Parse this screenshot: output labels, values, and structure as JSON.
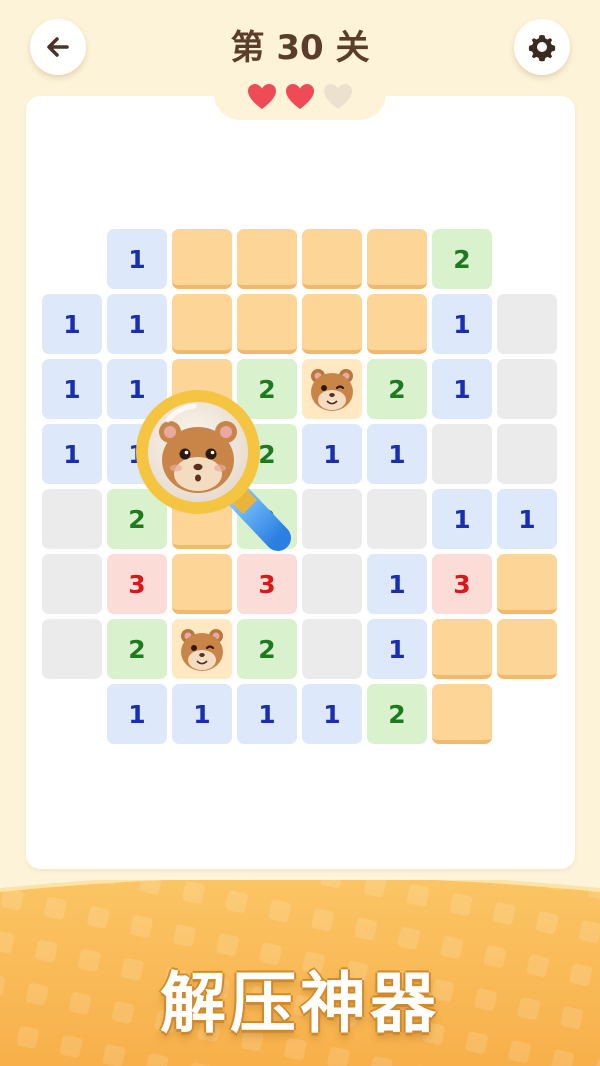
{
  "header": {
    "title": "第 30 关",
    "back_icon": "arrow-left-icon",
    "settings_icon": "gear-icon",
    "hearts": [
      {
        "state": "full",
        "color": "#ef4b57"
      },
      {
        "state": "full",
        "color": "#ef4b57"
      },
      {
        "state": "empty",
        "color": "#ece1cf"
      }
    ]
  },
  "board": {
    "columns": 8,
    "rows": 8,
    "cells": [
      [
        "none",
        "b1",
        "cov",
        "cov",
        "cov",
        "cov",
        "g2",
        "none"
      ],
      [
        "b1",
        "b1",
        "cov",
        "cov",
        "cov",
        "cov",
        "b1",
        "e"
      ],
      [
        "b1",
        "b1",
        "cov",
        "g2",
        "mole",
        "g2",
        "b1",
        "e"
      ],
      [
        "b1",
        "b1",
        "cov",
        "g2",
        "b1",
        "b1",
        "e",
        "e"
      ],
      [
        "e",
        "g2",
        "cov",
        "g2",
        "e",
        "e",
        "b1",
        "b1"
      ],
      [
        "e",
        "r3",
        "cov",
        "r3",
        "e",
        "b1",
        "r3",
        "cov"
      ],
      [
        "e",
        "g2",
        "mole",
        "g2",
        "e",
        "b1",
        "cov",
        "cov"
      ],
      [
        "none",
        "b1",
        "b1",
        "b1",
        "b1",
        "g2",
        "cov",
        "none"
      ]
    ],
    "labels": {
      "b1": "1",
      "g2": "2",
      "r3": "3"
    },
    "colors": {
      "covered": "#fdd597",
      "blue_number": "#1a2fb0",
      "green_number": "#1e7a1e",
      "red_number": "#d91919"
    }
  },
  "tool": {
    "icon": "magnifier-hint-icon"
  },
  "footer": {
    "slogan": "解压神器"
  }
}
